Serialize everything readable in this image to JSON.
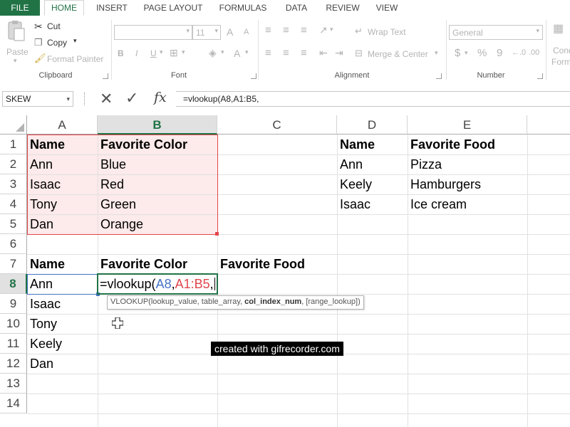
{
  "ribbon_tabs": [
    "FILE",
    "HOME",
    "INSERT",
    "PAGE LAYOUT",
    "FORMULAS",
    "DATA",
    "REVIEW",
    "VIEW"
  ],
  "active_tab": "HOME",
  "clipboard": {
    "paste": "Paste",
    "cut": "Cut",
    "copy": "Copy",
    "format_painter": "Format Painter",
    "label": "Clipboard"
  },
  "font": {
    "size": "11",
    "grow": "A",
    "shrink": "A",
    "bold": "B",
    "italic": "I",
    "underline": "U",
    "font_color": "A",
    "label": "Font"
  },
  "alignment": {
    "wrap_text": "Wrap Text",
    "merge_center": "Merge & Center",
    "label": "Alignment"
  },
  "number": {
    "format": "General",
    "currency": "$",
    "percent": "%",
    "comma": "9",
    "label": "Number"
  },
  "styles": {
    "cond_1": "Cond",
    "cond_2": "Form"
  },
  "formula_bar": {
    "name_box": "SKEW",
    "cancel": "✕",
    "enter": "✓",
    "fx": "fx",
    "formula": "=vlookup(A8,A1:B5,"
  },
  "columns": [
    "A",
    "B",
    "C",
    "D",
    "E"
  ],
  "rows": [
    "1",
    "2",
    "3",
    "4",
    "5",
    "6",
    "7",
    "8",
    "9",
    "10",
    "11",
    "12",
    "13",
    "14"
  ],
  "cells": {
    "A1": "Name",
    "B1": "Favorite Color",
    "D1": "Name",
    "E1": "Favorite Food",
    "A2": "Ann",
    "B2": "Blue",
    "D2": "Ann",
    "E2": "Pizza",
    "A3": "Isaac",
    "B3": "Red",
    "D3": "Keely",
    "E3": "Hamburgers",
    "A4": "Tony",
    "B4": "Green",
    "D4": "Isaac",
    "E4": "Ice cream",
    "A5": "Dan",
    "B5": "Orange",
    "A7": "Name",
    "B7": "Favorite Color",
    "C7": "Favorite Food",
    "A8": "Ann",
    "A9": "Isaac",
    "A10": "Tony",
    "A11": "Keely",
    "A12": "Dan"
  },
  "edit_cell": {
    "prefix": "=vlookup(",
    "ref1": "A8",
    "comma1": ",",
    "ref2": "A1:B5",
    "comma2": ","
  },
  "tooltip": {
    "fn": "VLOOKUP(lookup_value, table_array, ",
    "current_arg": "col_index_num",
    "rest": ", [range_lookup])"
  },
  "watermark": "created with gifrecorder.com",
  "colors": {
    "accent": "#217346",
    "ref1": "#4472c4",
    "ref2": "#e0474c"
  }
}
